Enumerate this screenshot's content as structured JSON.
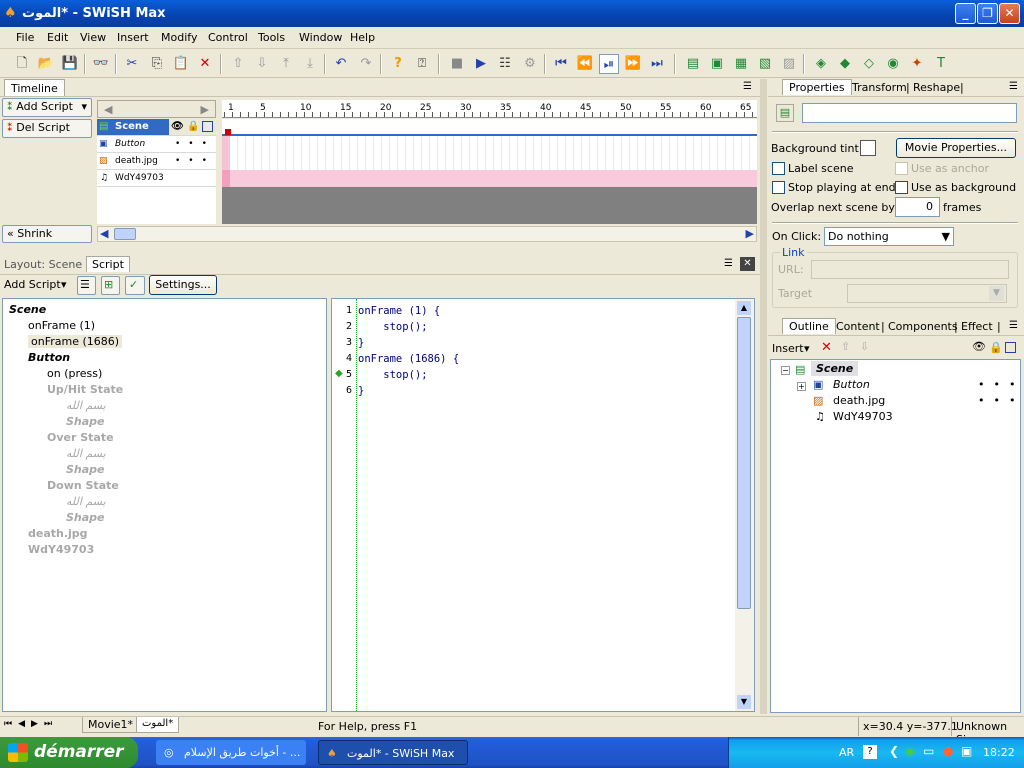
{
  "window": {
    "title": "الموت* - SWiSH Max",
    "app_icon": "swish-icon"
  },
  "menu": [
    "File",
    "Edit",
    "View",
    "Insert",
    "Modify",
    "Control",
    "Tools",
    "Window",
    "Help"
  ],
  "timeline": {
    "tab": "Timeline",
    "add_script": "Add Script",
    "del_script": "Del Script",
    "shrink": "Shrink",
    "ruler": [
      "1",
      "5",
      "10",
      "15",
      "20",
      "25",
      "30",
      "35",
      "40",
      "45",
      "50",
      "55",
      "60",
      "65"
    ],
    "layers": [
      {
        "name": "Scene",
        "icon": "scene-icon"
      },
      {
        "name": "Button",
        "icon": "button-icon"
      },
      {
        "name": "death.jpg",
        "icon": "image-icon"
      },
      {
        "name": "WdY49703",
        "icon": "sound-icon"
      }
    ]
  },
  "script_panel": {
    "tab_layout": "Layout: Scene",
    "tab_script": "Script",
    "add_script": "Add Script",
    "settings": "Settings...",
    "tree": [
      {
        "text": "Scene",
        "style": "bold-italic",
        "level": 0
      },
      {
        "text": "onFrame (1)",
        "style": "normal",
        "level": 1
      },
      {
        "text": "onFrame (1686)",
        "style": "selected",
        "level": 1
      },
      {
        "text": "Button",
        "style": "bold-italic",
        "level": 1
      },
      {
        "text": "on (press)",
        "style": "normal",
        "level": 2
      },
      {
        "text": "Up/Hit State",
        "style": "gray-bold",
        "level": 2
      },
      {
        "text": "بسم الله",
        "style": "gray-italic",
        "level": 3
      },
      {
        "text": "Shape",
        "style": "gray-bold-italic",
        "level": 3
      },
      {
        "text": "Over State",
        "style": "gray-bold",
        "level": 2
      },
      {
        "text": "بسم الله",
        "style": "gray-italic",
        "level": 3
      },
      {
        "text": "Shape",
        "style": "gray-bold-italic",
        "level": 3
      },
      {
        "text": "Down State",
        "style": "gray-bold",
        "level": 2
      },
      {
        "text": "بسم الله",
        "style": "gray-italic",
        "level": 3
      },
      {
        "text": "Shape",
        "style": "gray-bold-italic",
        "level": 3
      },
      {
        "text": "death.jpg",
        "style": "gray-bold",
        "level": 1
      },
      {
        "text": "WdY49703",
        "style": "gray-bold",
        "level": 1
      }
    ],
    "code": [
      {
        "num": "1",
        "text": "onFrame (1) {"
      },
      {
        "num": "2",
        "text": "    stop();"
      },
      {
        "num": "3",
        "text": "}"
      },
      {
        "num": "4",
        "text": "onFrame (1686) {"
      },
      {
        "num": "5",
        "text": "    stop();"
      },
      {
        "num": "6",
        "text": "}"
      }
    ]
  },
  "properties": {
    "tabs": [
      "Properties",
      "Transform",
      "Reshape"
    ],
    "background_tint": "Background tint:",
    "movie_properties": "Movie Properties...",
    "label_scene": "Label scene",
    "use_as_anchor": "Use as anchor",
    "stop_playing": "Stop playing at end",
    "use_as_background": "Use as background",
    "overlap": "Overlap next scene by:",
    "overlap_value": "0",
    "frames": "frames",
    "on_click": "On Click:",
    "on_click_value": "Do nothing",
    "link": "Link",
    "url": "URL:",
    "target": "Target"
  },
  "outline": {
    "tabs": [
      "Outline",
      "Content",
      "Components",
      "Effect"
    ],
    "insert": "Insert",
    "items": [
      {
        "name": "Scene",
        "icon": "scene-icon"
      },
      {
        "name": "Button",
        "icon": "button-icon"
      },
      {
        "name": "death.jpg",
        "icon": "image-icon"
      },
      {
        "name": "WdY49703",
        "icon": "sound-icon"
      }
    ]
  },
  "status": {
    "tabs": [
      "Movie1*",
      "الموت*"
    ],
    "help": "For Help, press F1",
    "coords": "x=30.4 y=-377.1",
    "size": "Unknown Size"
  },
  "taskbar": {
    "start": "démarrer",
    "tasks": [
      "أخوات طريق الإسلام - ...",
      "الموت* - SWiSH Max"
    ],
    "lang": "AR",
    "time": "18:22"
  }
}
